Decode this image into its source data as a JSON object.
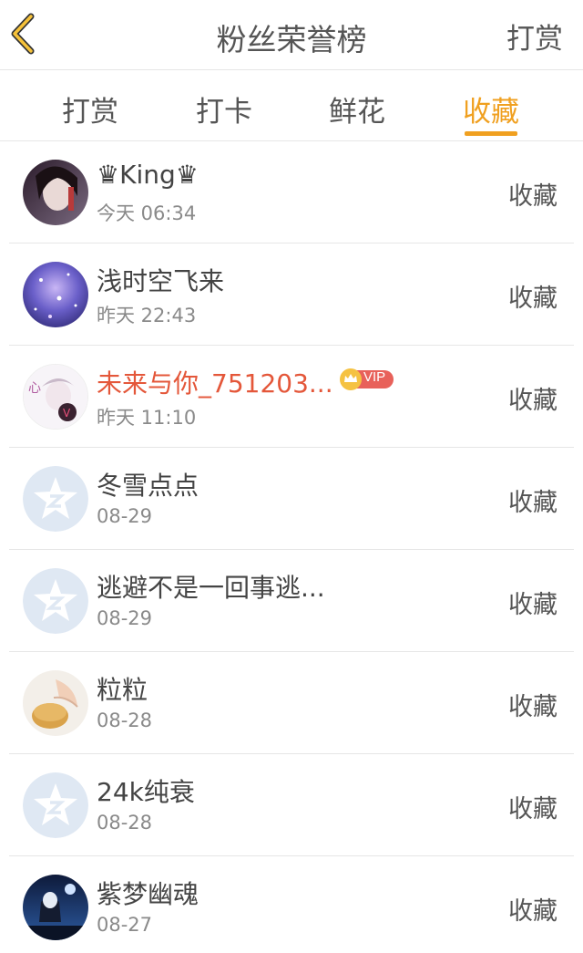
{
  "header": {
    "title": "粉丝荣誉榜",
    "right_action": "打赏"
  },
  "tabs": [
    {
      "label": "打赏",
      "active": false
    },
    {
      "label": "打卡",
      "active": false
    },
    {
      "label": "鲜花",
      "active": false
    },
    {
      "label": "收藏",
      "active": true
    }
  ],
  "colors": {
    "accent": "#f0a020",
    "vip_name": "#e4573a",
    "vip_badge": "#e8615a"
  },
  "fans": [
    {
      "name": "♛King♛",
      "time": "今天 06:34",
      "action": "收藏",
      "avatar": "photo-dark"
    },
    {
      "name": "浅时空飞来",
      "time": "昨天 22:43",
      "action": "收藏",
      "avatar": "photo-purple"
    },
    {
      "name": "未来与你_751203...",
      "time": "昨天 11:10",
      "action": "收藏",
      "avatar": "photo-anime",
      "vip": true,
      "vip_label": "VIP"
    },
    {
      "name": "冬雪点点",
      "time": "08-29",
      "action": "收藏",
      "avatar": "default-star"
    },
    {
      "name": "逃避不是一回事逃...",
      "time": "08-29",
      "action": "收藏",
      "avatar": "default-star"
    },
    {
      "name": "粒粒",
      "time": "08-28",
      "action": "收藏",
      "avatar": "photo-hand"
    },
    {
      "name": "24k纯衰",
      "time": "08-28",
      "action": "收藏",
      "avatar": "default-star"
    },
    {
      "name": "紫梦幽魂",
      "time": "08-27",
      "action": "收藏",
      "avatar": "photo-night"
    }
  ]
}
